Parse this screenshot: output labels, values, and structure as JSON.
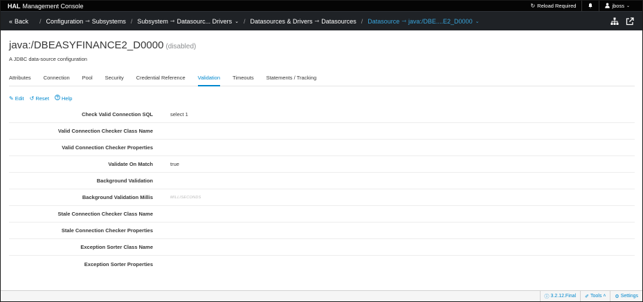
{
  "topbar": {
    "brand_bold": "HAL",
    "brand_rest": "Management Console",
    "reload": "Reload Required",
    "user": "jboss"
  },
  "nav": {
    "back": "Back",
    "crumbs": [
      {
        "a": "Configuration",
        "b": "Subsystems"
      },
      {
        "a": "Subsystem",
        "b": "Datasourc... Drivers"
      },
      {
        "a": "Datasources & Drivers",
        "b": "Datasources"
      },
      {
        "a": "Datasource",
        "b": "java:/DBE....E2_D0000"
      }
    ]
  },
  "page": {
    "title": "java:/DBEASYFINANCE2_D0000",
    "status": "(disabled)",
    "subtitle": "A JDBC data-source configuration"
  },
  "tabs": [
    "Attributes",
    "Connection",
    "Pool",
    "Security",
    "Credential Reference",
    "Validation",
    "Timeouts",
    "Statements / Tracking"
  ],
  "active_tab": "Validation",
  "toolbar": {
    "edit": "Edit",
    "reset": "Reset",
    "help": "Help"
  },
  "attributes": [
    {
      "label": "Check Valid Connection SQL",
      "value": "select 1"
    },
    {
      "label": "Valid Connection Checker Class Name",
      "value": ""
    },
    {
      "label": "Valid Connection Checker Properties",
      "value": ""
    },
    {
      "label": "Validate On Match",
      "value": "true"
    },
    {
      "label": "Background Validation",
      "value": ""
    },
    {
      "label": "Background Validation Millis",
      "value": "",
      "placeholder": "MILLISECONDS"
    },
    {
      "label": "Stale Connection Checker Class Name",
      "value": ""
    },
    {
      "label": "Stale Connection Checker Properties",
      "value": ""
    },
    {
      "label": "Exception Sorter Class Name",
      "value": ""
    },
    {
      "label": "Exception Sorter Properties",
      "value": ""
    }
  ],
  "footer": {
    "version": "3.2.12.Final",
    "tools": "Tools",
    "settings": "Settings"
  },
  "colors": {
    "accent": "#0088ce",
    "crumb_active": "#39a5dc",
    "topbar": "#050505",
    "navbar": "#1f2226"
  }
}
